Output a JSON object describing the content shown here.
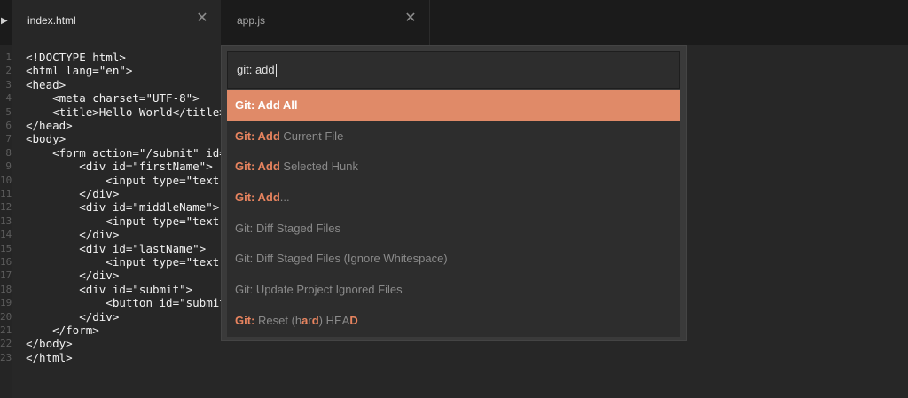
{
  "tabs": [
    {
      "label": "index.html",
      "active": true
    },
    {
      "label": "app.js",
      "active": false
    }
  ],
  "icons": {
    "tab_scroll": "play-arrow-icon",
    "tab_close": "close-icon"
  },
  "gutter": {
    "line_numbers": [
      "1",
      "2",
      "3",
      "4",
      "5",
      "6",
      "7",
      "8",
      "9",
      "10",
      "11",
      "12",
      "13",
      "14",
      "15",
      "16",
      "17",
      "18",
      "19",
      "20",
      "21",
      "22",
      "23"
    ]
  },
  "code_lines": [
    "<!DOCTYPE html>",
    "<html lang=\"en\">",
    "<head>",
    "    <meta charset=\"UTF-8\">",
    "    <title>Hello World</title>",
    "</head>",
    "<body>",
    "    <form action=\"/submit\" id=\"",
    "        <div id=\"firstName\">",
    "            <input type=\"text\"",
    "        </div>",
    "        <div id=\"middleName\">",
    "            <input type=\"text\"",
    "        </div>",
    "        <div id=\"lastName\">",
    "            <input type=\"text\"",
    "        </div>",
    "        <div id=\"submit\">",
    "            <button id=\"submitB",
    "        </div>",
    "    </form>",
    "</body>",
    "</html>"
  ],
  "palette": {
    "query": "git: add",
    "items": [
      {
        "parts": [
          [
            "Git: Add All",
            true
          ]
        ],
        "selected": true
      },
      {
        "parts": [
          [
            "Git: Add",
            true
          ],
          [
            " Current File",
            false
          ]
        ],
        "selected": false
      },
      {
        "parts": [
          [
            "Git: Add",
            true
          ],
          [
            " Selected Hunk",
            false
          ]
        ],
        "selected": false
      },
      {
        "parts": [
          [
            "Git: Add",
            true
          ],
          [
            "...",
            false
          ]
        ],
        "selected": false
      },
      {
        "parts": [
          [
            "Git: Diff Staged Files",
            false
          ]
        ],
        "selected": false
      },
      {
        "parts": [
          [
            "Git: Diff Staged Files (Ignore Whitespace)",
            false
          ]
        ],
        "selected": false
      },
      {
        "parts": [
          [
            "Git: Update Project Ignored Files",
            false
          ]
        ],
        "selected": false
      },
      {
        "parts": [
          [
            "Git:",
            true
          ],
          [
            " Reset (h",
            false
          ],
          [
            "a",
            true
          ],
          [
            "r",
            false
          ],
          [
            "d",
            true
          ],
          [
            ") HEA",
            false
          ],
          [
            "D",
            true
          ]
        ],
        "selected": false
      }
    ]
  },
  "colors": {
    "accent": "#e08a68",
    "match_highlight": "#e8845f",
    "background": "#272727"
  }
}
